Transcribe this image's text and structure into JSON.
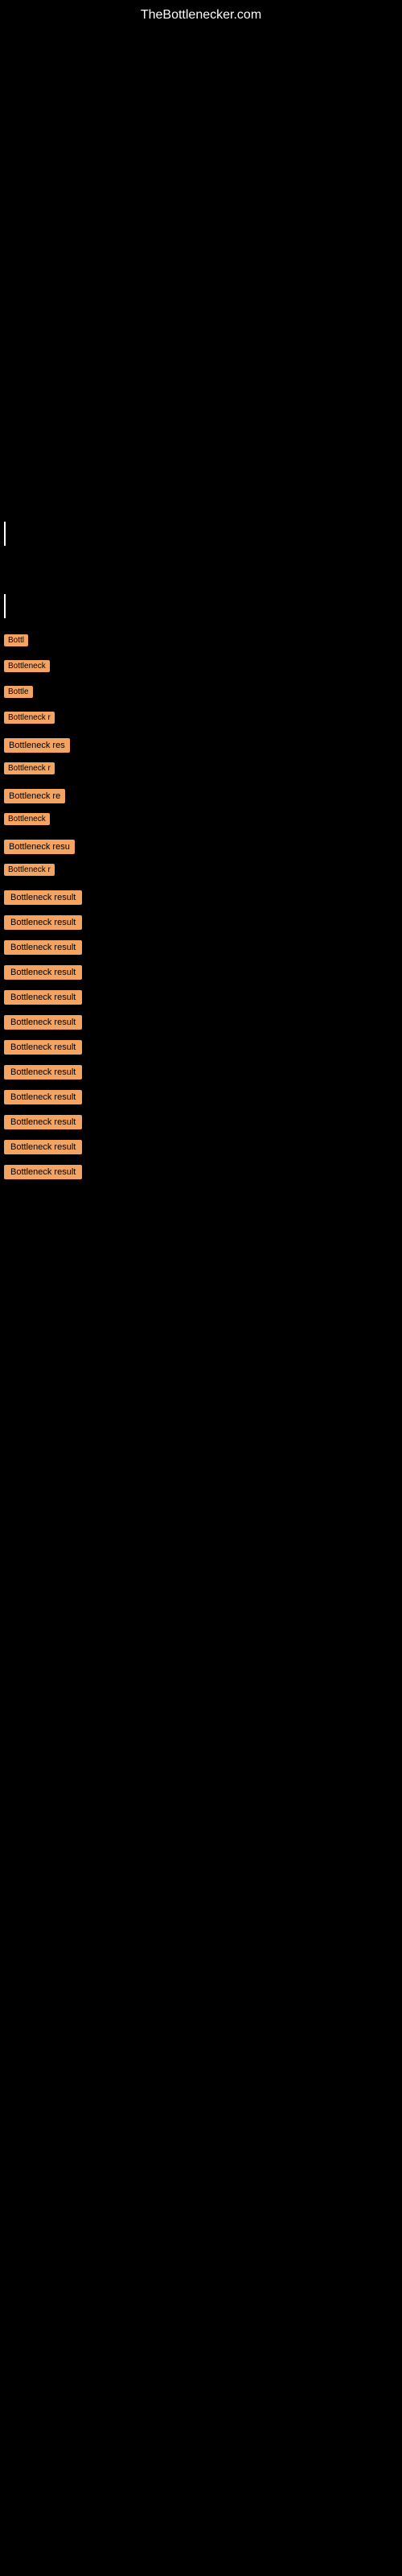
{
  "site": {
    "title": "TheBottlenecker.com"
  },
  "bottleneck_items": [
    {
      "id": 1,
      "label": "Bottl",
      "size": "small"
    },
    {
      "id": 2,
      "label": "Bottleneck",
      "size": "medium"
    },
    {
      "id": 3,
      "label": "Bottle",
      "size": "small"
    },
    {
      "id": 4,
      "label": "Bottleneck r",
      "size": "medium"
    },
    {
      "id": 5,
      "label": "Bottleneck res",
      "size": "large"
    },
    {
      "id": 6,
      "label": "Bottleneck r",
      "size": "medium"
    },
    {
      "id": 7,
      "label": "Bottleneck re",
      "size": "large"
    },
    {
      "id": 8,
      "label": "Bottleneck",
      "size": "medium"
    },
    {
      "id": 9,
      "label": "Bottleneck resu",
      "size": "large"
    },
    {
      "id": 10,
      "label": "Bottleneck r",
      "size": "medium"
    },
    {
      "id": 11,
      "label": "Bottleneck result",
      "size": "full"
    },
    {
      "id": 12,
      "label": "Bottleneck result",
      "size": "full"
    },
    {
      "id": 13,
      "label": "Bottleneck result",
      "size": "full"
    },
    {
      "id": 14,
      "label": "Bottleneck result",
      "size": "full"
    },
    {
      "id": 15,
      "label": "Bottleneck result",
      "size": "full"
    },
    {
      "id": 16,
      "label": "Bottleneck result",
      "size": "full"
    },
    {
      "id": 17,
      "label": "Bottleneck result",
      "size": "full"
    },
    {
      "id": 18,
      "label": "Bottleneck result",
      "size": "full"
    },
    {
      "id": 19,
      "label": "Bottleneck result",
      "size": "full"
    },
    {
      "id": 20,
      "label": "Bottleneck result",
      "size": "full"
    },
    {
      "id": 21,
      "label": "Bottleneck result",
      "size": "full"
    },
    {
      "id": 22,
      "label": "Bottleneck result",
      "size": "full"
    }
  ],
  "colors": {
    "background": "#000000",
    "badge_bg": "#f4a460",
    "text": "#ffffff"
  }
}
